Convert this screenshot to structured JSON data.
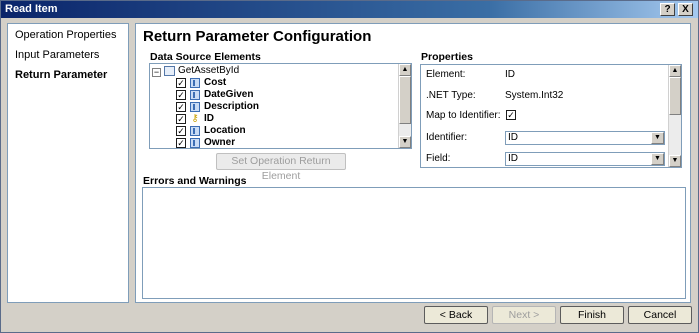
{
  "window": {
    "title": "Read Item",
    "help_glyph": "?",
    "close_glyph": "X"
  },
  "nav": {
    "items": [
      {
        "label": "Operation Properties",
        "active": false
      },
      {
        "label": "Input Parameters",
        "active": false
      },
      {
        "label": "Return Parameter",
        "active": true
      }
    ]
  },
  "main": {
    "heading": "Return Parameter Configuration",
    "data_source": {
      "label": "Data Source Elements",
      "root": {
        "label": "GetAssetById",
        "expander": "−",
        "icon": "object-icon"
      },
      "fields": [
        {
          "label": "Cost",
          "checked": true,
          "icon": "field-icon"
        },
        {
          "label": "DateGiven",
          "checked": true,
          "icon": "field-icon"
        },
        {
          "label": "Description",
          "checked": true,
          "icon": "field-icon"
        },
        {
          "label": "ID",
          "checked": true,
          "icon": "key-icon"
        },
        {
          "label": "Location",
          "checked": true,
          "icon": "field-icon"
        },
        {
          "label": "Owner",
          "checked": true,
          "icon": "field-icon"
        }
      ],
      "check_glyph": "✓",
      "set_button": "Set Operation Return Element"
    },
    "properties": {
      "label": "Properties",
      "element_label": "Element:",
      "element_value": "ID",
      "net_type_label": ".NET Type:",
      "net_type_value": "System.Int32",
      "map_label": "Map to Identifier:",
      "map_checked": true,
      "identifier_label": "Identifier:",
      "identifier_value": "ID",
      "field_label": "Field:",
      "field_value": "ID"
    },
    "errors": {
      "label": "Errors and Warnings"
    }
  },
  "footer": {
    "back": "< Back",
    "next": "Next >",
    "finish": "Finish",
    "cancel": "Cancel"
  },
  "colors": {
    "titlebar_start": "#0a246a",
    "titlebar_end": "#a6caf0",
    "dialog_bg": "#d4d0c8",
    "panel_border": "#7f9db9"
  },
  "glyphs": {
    "arrow_up": "▲",
    "arrow_down": "▼"
  }
}
